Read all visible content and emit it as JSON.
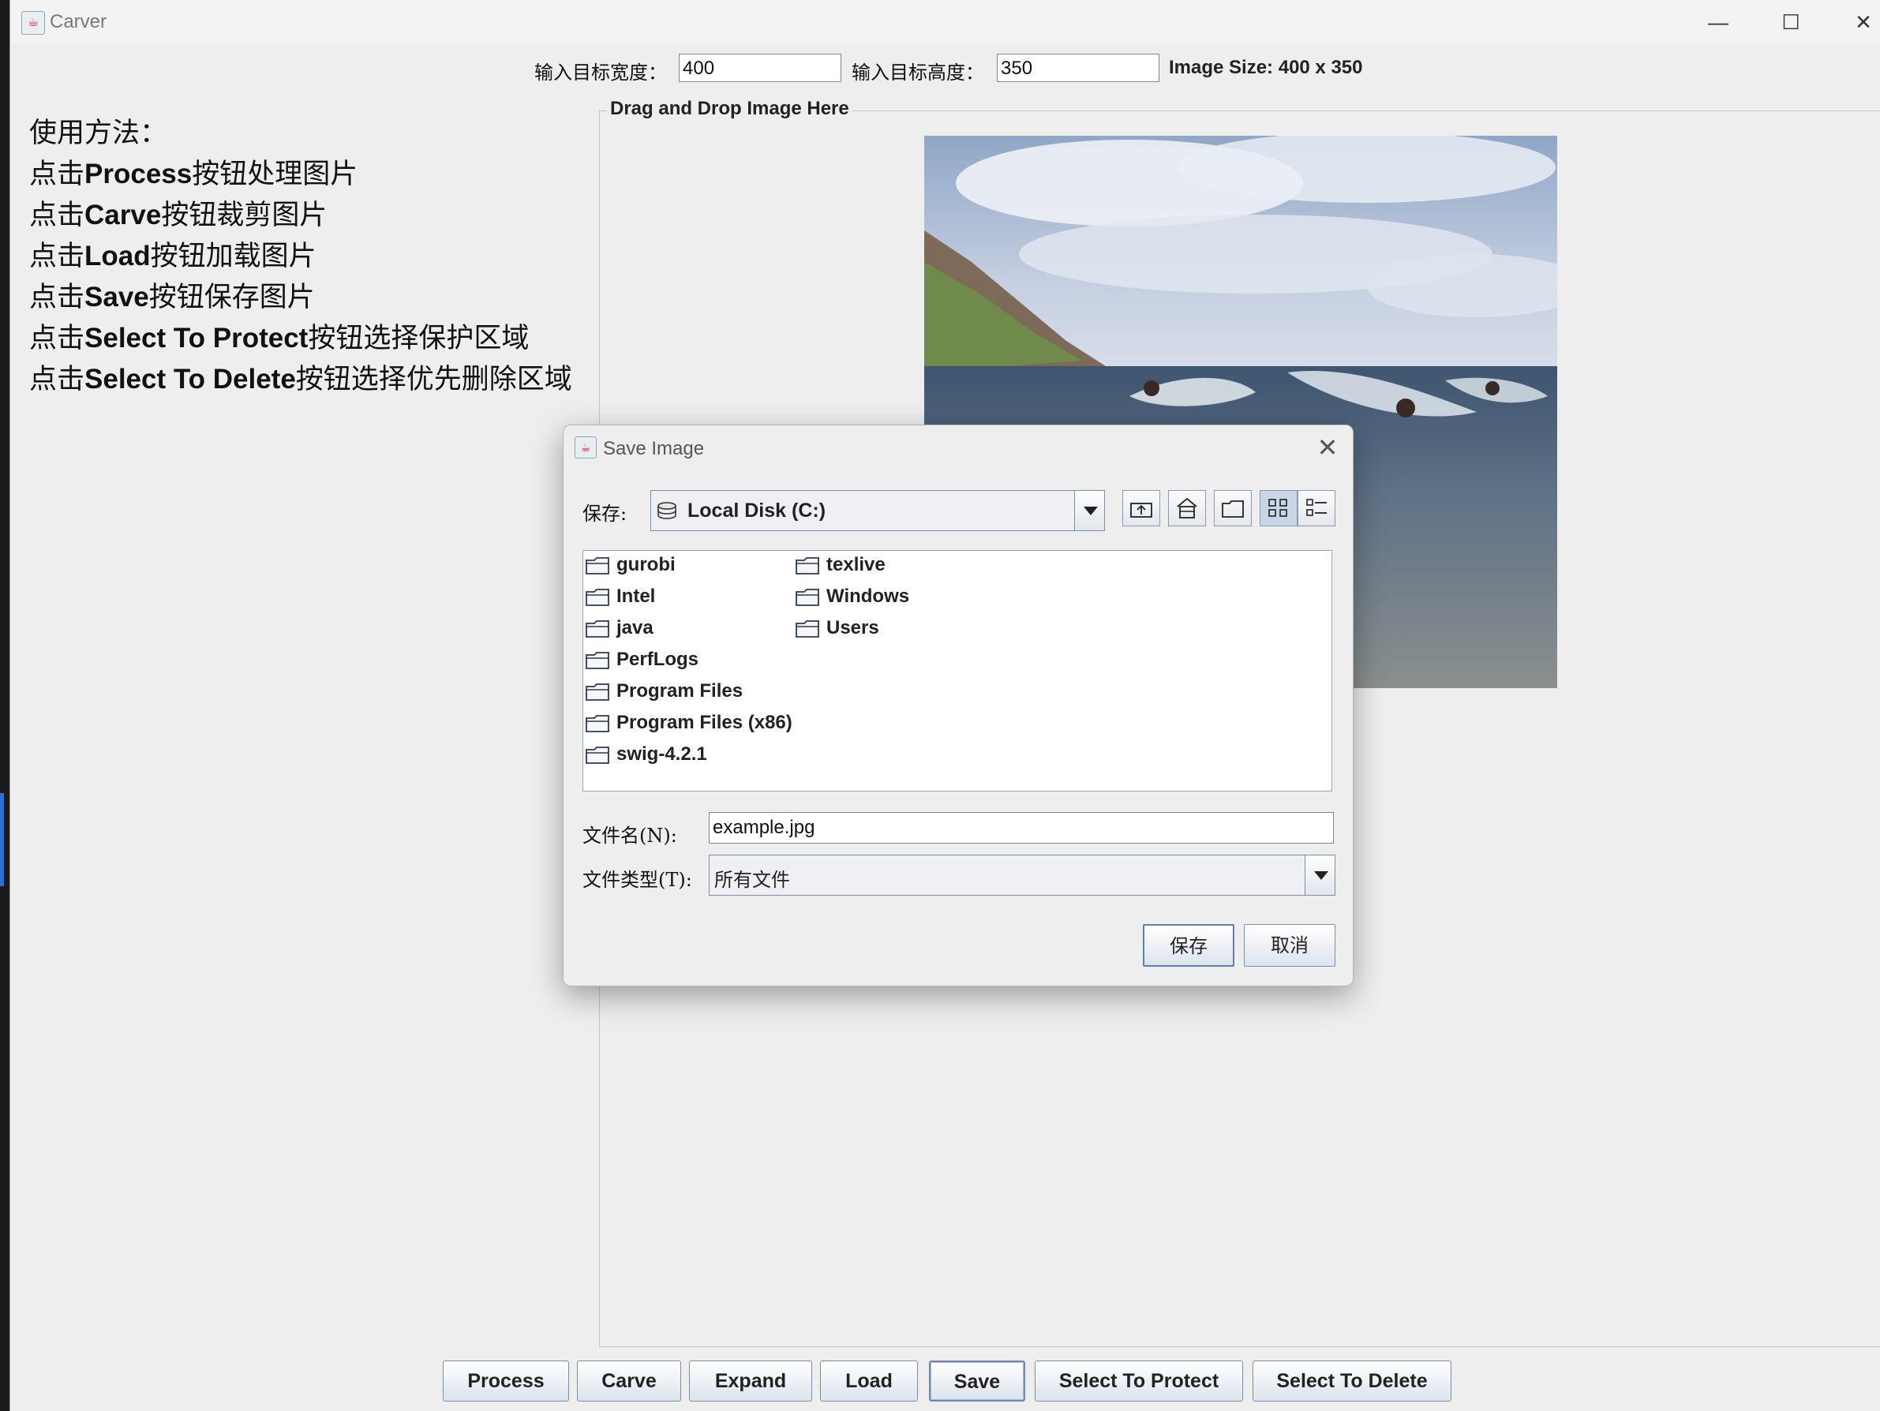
{
  "window": {
    "title": "Carver",
    "controls": {
      "minimize": "—",
      "maximize": "☐",
      "close": "✕"
    }
  },
  "top_bar": {
    "width_label": "输入目标宽度：",
    "width_value": "400",
    "height_label": "输入目标高度：",
    "height_value": "350",
    "image_size": "Image Size: 400 x 350"
  },
  "instructions": {
    "heading": "使用方法：",
    "lines": [
      {
        "pre": "点击",
        "key": "Process",
        "post": "按钮处理图片"
      },
      {
        "pre": "点击",
        "key": "Carve",
        "post": "按钮裁剪图片"
      },
      {
        "pre": "点击",
        "key": "Load",
        "post": "按钮加载图片"
      },
      {
        "pre": "点击",
        "key": "Save",
        "post": "按钮保存图片"
      },
      {
        "pre": "点击",
        "key": "Select To Protect",
        "post": "按钮选择保护区域"
      },
      {
        "pre": "点击",
        "key": "Select To Delete",
        "post": "按钮选择优先删除区域"
      }
    ]
  },
  "drop_panel": {
    "title": "Drag and Drop Image Here"
  },
  "buttons": [
    "Process",
    "Carve",
    "Expand",
    "Load",
    "Save",
    "Select To Protect",
    "Select To Delete"
  ],
  "dialog": {
    "title": "Save Image",
    "close": "✕",
    "save_in_label": "保存:",
    "location": "Local Disk (C:)",
    "folders_col1": [
      "gurobi",
      "Intel",
      "java",
      "PerfLogs",
      "Program Files",
      "Program Files (x86)",
      "swig-4.2.1"
    ],
    "folders_col2": [
      "texlive",
      "Windows",
      "Users"
    ],
    "filename_label": "文件名(N):",
    "filename_value": "example.jpg",
    "filetype_label": "文件类型(T):",
    "filetype_value": "所有文件",
    "save_button": "保存",
    "cancel_button": "取消"
  },
  "colors": {
    "window_bg": "#eeeeee",
    "accent_border": "#7d8fa8",
    "selected_tool": "#c9d6e8"
  }
}
